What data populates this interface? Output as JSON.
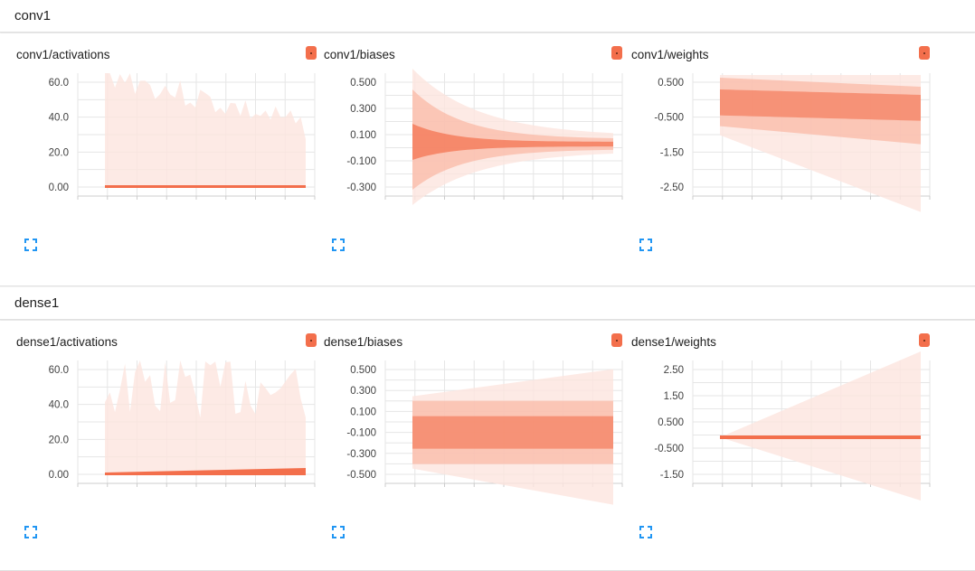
{
  "accent_color": "#f36f4c",
  "sections": [
    {
      "title": "conv1",
      "cards": [
        {
          "title": "conv1/activations",
          "ticks": [
            "60.0",
            "40.0",
            "20.0",
            "0.00"
          ],
          "shape": "activations"
        },
        {
          "title": "conv1/biases",
          "ticks": [
            "0.500",
            "0.300",
            "0.100",
            "-0.100",
            "-0.300"
          ],
          "shape": "converge"
        },
        {
          "title": "conv1/weights",
          "ticks": [
            "0.500",
            "-0.500",
            "-1.50",
            "-2.50"
          ],
          "shape": "drift"
        }
      ]
    },
    {
      "title": "dense1",
      "cards": [
        {
          "title": "dense1/activations",
          "ticks": [
            "60.0",
            "40.0",
            "20.0",
            "0.00"
          ],
          "shape": "spiky"
        },
        {
          "title": "dense1/biases",
          "ticks": [
            "0.500",
            "0.300",
            "0.100",
            "-0.100",
            "-0.300",
            "-0.500"
          ],
          "shape": "band"
        },
        {
          "title": "dense1/weights",
          "ticks": [
            "2.50",
            "1.50",
            "0.500",
            "-0.500",
            "-1.50"
          ],
          "shape": "fan"
        }
      ]
    }
  ]
}
